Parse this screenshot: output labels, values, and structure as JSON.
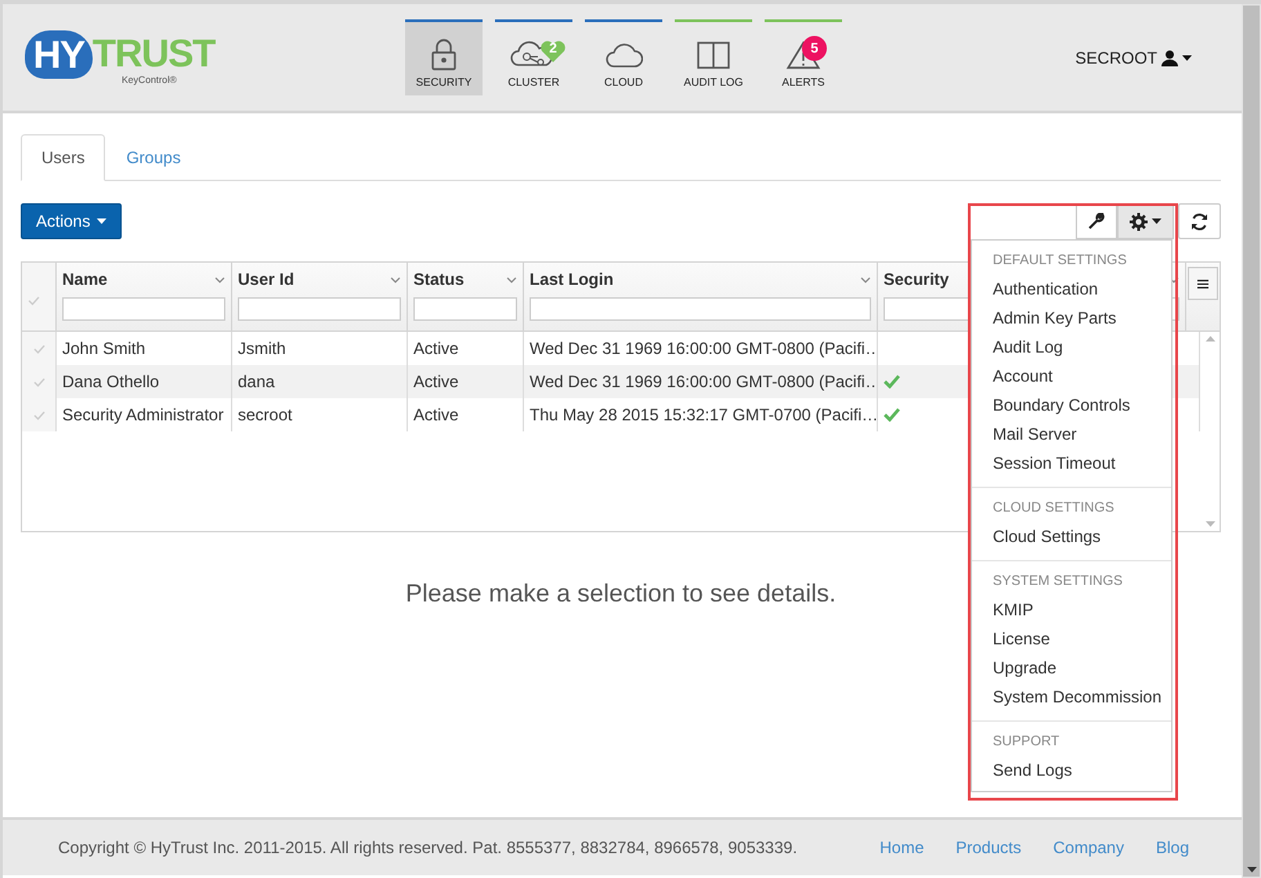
{
  "logo": {
    "mark": "HY",
    "word": "TRUST",
    "subtitle": "KeyControl®"
  },
  "nav": [
    {
      "label": "SECURITY",
      "kind": "lock",
      "selected": true,
      "color": "#2a6ebb"
    },
    {
      "label": "CLUSTER",
      "kind": "cluster",
      "selected": false,
      "color": "#2a6ebb",
      "badge": "2"
    },
    {
      "label": "CLOUD",
      "kind": "cloud",
      "selected": false,
      "color": "#2a6ebb"
    },
    {
      "label": "AUDIT LOG",
      "kind": "book",
      "selected": false,
      "color": "#7dc35b"
    },
    {
      "label": "ALERTS",
      "kind": "warning",
      "selected": false,
      "color": "#7dc35b",
      "badge": "5"
    }
  ],
  "user_menu": {
    "label": "SECROOT"
  },
  "tabs": [
    {
      "label": "Users",
      "selected": true
    },
    {
      "label": "Groups",
      "selected": false
    }
  ],
  "actions_button": "Actions",
  "table": {
    "columns": [
      "Name",
      "User Id",
      "Status",
      "Last Login",
      "Security"
    ],
    "rows": [
      {
        "name": "John Smith",
        "user_id": "Jsmith",
        "status": "Active",
        "last_login": "Wed Dec 31 1969 16:00:00 GMT-0800 (Pacifi…",
        "secure": false
      },
      {
        "name": "Dana Othello",
        "user_id": "dana",
        "status": "Active",
        "last_login": "Wed Dec 31 1969 16:00:00 GMT-0800 (Pacifi…",
        "secure": true
      },
      {
        "name": "Security Administrator",
        "user_id": "secroot",
        "status": "Active",
        "last_login": "Thu May 28 2015 15:32:17 GMT-0700 (Pacifi…",
        "secure": true
      }
    ]
  },
  "settings_menu": {
    "sections": [
      {
        "heading": "DEFAULT SETTINGS",
        "items": [
          "Authentication",
          "Admin Key Parts",
          "Audit Log",
          "Account",
          "Boundary Controls",
          "Mail Server",
          "Session Timeout"
        ]
      },
      {
        "heading": "CLOUD SETTINGS",
        "items": [
          "Cloud Settings"
        ]
      },
      {
        "heading": "SYSTEM SETTINGS",
        "items": [
          "KMIP",
          "License",
          "Upgrade",
          "System Decommission"
        ]
      },
      {
        "heading": "SUPPORT",
        "items": [
          "Send Logs"
        ]
      }
    ]
  },
  "empty_message": "Please make a selection to see details.",
  "footer": {
    "copyright": "Copyright © HyTrust Inc. 2011-2015. All rights reserved. Pat. 8555377, 8832784, 8966578, 9053339.",
    "links": [
      "Home",
      "Products",
      "Company",
      "Blog"
    ]
  }
}
